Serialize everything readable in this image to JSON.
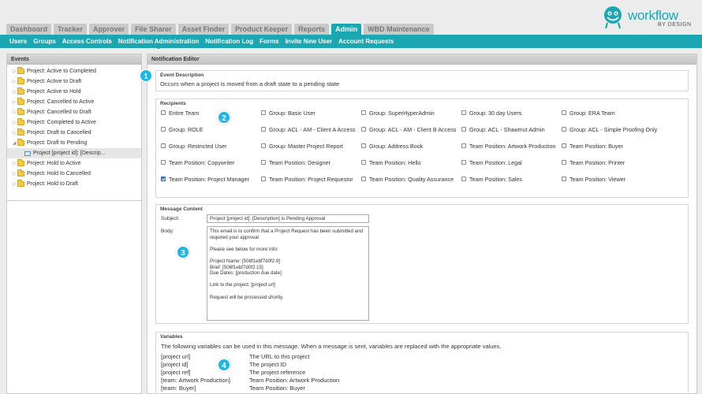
{
  "nav": {
    "tabs": [
      {
        "label": "Dashboard"
      },
      {
        "label": "Tracker"
      },
      {
        "label": "Approver"
      },
      {
        "label": "File Sharer"
      },
      {
        "label": "Asset Finder"
      },
      {
        "label": "Product Keeper"
      },
      {
        "label": "Reports"
      },
      {
        "label": "Admin",
        "active": true
      },
      {
        "label": "WBD Maintenance"
      }
    ],
    "subitems": [
      {
        "label": "Users"
      },
      {
        "label": "Groups"
      },
      {
        "label": "Access Controls"
      },
      {
        "label": "Notification Administration",
        "active": true
      },
      {
        "label": "Notification Log"
      },
      {
        "label": "Forms"
      },
      {
        "label": "Invite New User"
      },
      {
        "label": "Account Requests"
      }
    ]
  },
  "logo": {
    "word": "workflow",
    "sub": "BY DESIGN",
    "color": "#1aa7b2"
  },
  "events": {
    "title": "Events",
    "items": [
      {
        "label": "Project: Active to Completed",
        "expanded": false
      },
      {
        "label": "Project: Active to Draft",
        "expanded": false
      },
      {
        "label": "Project: Active to Hold",
        "expanded": false
      },
      {
        "label": "Project: Cancelled to Active",
        "expanded": false
      },
      {
        "label": "Project: Cancelled to Draft",
        "expanded": false
      },
      {
        "label": "Project: Completed to Active",
        "expanded": false
      },
      {
        "label": "Project: Draft to Cancelled",
        "expanded": false
      },
      {
        "label": "Project: Draft to Pending",
        "expanded": true
      },
      {
        "label": "Project [project id]: [Descrip...",
        "child": true
      },
      {
        "label": "Project: Hold to Active",
        "expanded": false
      },
      {
        "label": "Project: Hold to Cancelled",
        "expanded": false
      },
      {
        "label": "Project: Hold to Draft",
        "expanded": false
      }
    ]
  },
  "editor": {
    "title": "Notification Editor",
    "description": {
      "title": "Event Description",
      "text": "Occurs when a project is moved from a draft state to a pending state"
    },
    "recipients": {
      "title": "Recipients",
      "items": [
        {
          "label": "Entire Team",
          "checked": false
        },
        {
          "label": "Group: Basic User",
          "checked": false
        },
        {
          "label": "Group: SuperHyperAdmin",
          "checked": false
        },
        {
          "label": "Group: 30 day Users",
          "checked": false
        },
        {
          "label": "Group: ERA Team",
          "checked": false
        },
        {
          "label": "Group: ROLE",
          "checked": false
        },
        {
          "label": "Group: ACL - AM - Client A Access",
          "checked": false
        },
        {
          "label": "Group: ACL - AM - Client B Access",
          "checked": false
        },
        {
          "label": "Group: ACL - Shawmut Admin",
          "checked": false
        },
        {
          "label": "Group: ACL - Simple Proofing Only",
          "checked": false
        },
        {
          "label": "Group: Restricted User",
          "checked": false
        },
        {
          "label": "Group: Master Project Report",
          "checked": false
        },
        {
          "label": "Group: Address Book",
          "checked": false
        },
        {
          "label": "Team Position: Artwork Production",
          "checked": false
        },
        {
          "label": "Team Position: Buyer",
          "checked": false
        },
        {
          "label": "Team Position: Copywriter",
          "checked": false
        },
        {
          "label": "Team Position: Designer",
          "checked": false
        },
        {
          "label": "Team Position: Hello",
          "checked": false
        },
        {
          "label": "Team Position: Legal",
          "checked": false
        },
        {
          "label": "Team Position: Printer",
          "checked": false
        },
        {
          "label": "Team Position: Project Manager",
          "checked": true
        },
        {
          "label": "Team Position: Project Requestor",
          "checked": false
        },
        {
          "label": "Team Position: Quality Assurance",
          "checked": false
        },
        {
          "label": "Team Position: Sales",
          "checked": false
        },
        {
          "label": "Team Position: Viewer",
          "checked": false
        }
      ]
    },
    "message": {
      "title": "Message Content",
      "subject_label": "Subject:",
      "subject_value": "Project [project id]: [Description] is Pending Approval",
      "body_label": "Body:",
      "body_value": "This email is to confirm that a Project Request has been submitted and\nrequired your approval\n\nPlease see below for more info:\n\nProject Name: [508f1ebf7d0f2.9]\nBrief: [508f1ebf7d0f2.15]\nDue Dates: [production due date]\n\nLink to the project: [project url]\n\nRequest will be processed shortly."
    },
    "variables": {
      "title": "Variables",
      "intro": "The following variables can be used in this message. When a message is sent, variables are replaced with the appropriate values.",
      "rows": [
        {
          "key": "[project url]",
          "desc": "The URL to this project"
        },
        {
          "key": "[project id]",
          "desc": "The project ID"
        },
        {
          "key": "[project ref]",
          "desc": "The project reference"
        },
        {
          "key": "[team: Artwork Production]",
          "desc": "Team Position: Artwork Production"
        },
        {
          "key": "[team: Buyer]",
          "desc": "Team Position: Buyer"
        }
      ]
    }
  },
  "callouts": [
    "1",
    "2",
    "3",
    "4"
  ],
  "colors": {
    "accent": "#1aa7b2",
    "callout": "#1fb5e6",
    "checkbox": "#3c7fd1"
  }
}
